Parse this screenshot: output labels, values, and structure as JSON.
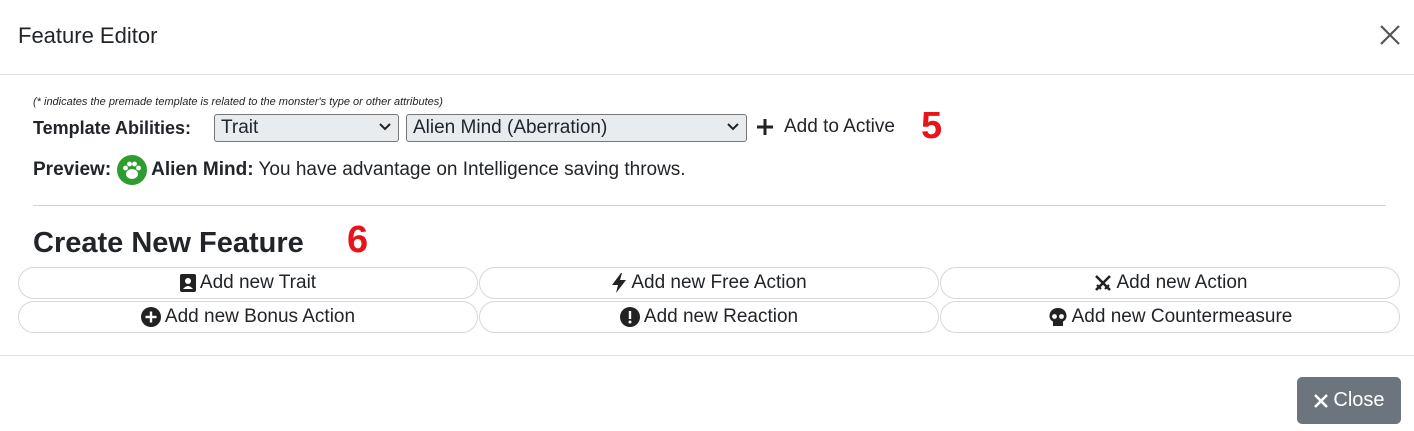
{
  "header": {
    "title": "Feature Editor",
    "close_icon": "close-icon"
  },
  "template": {
    "note": "(* indicates the premade template is related to the monster's type or other attributes)",
    "label": "Template Abilities:",
    "type_select": "Trait",
    "ability_select": "Alien Mind (Aberration)",
    "add_label": "Add to Active",
    "step_marker": "5"
  },
  "preview": {
    "label": "Preview:",
    "icon": "paw-icon",
    "name": "Alien Mind:",
    "text": " You have advantage on Intelligence saving throws."
  },
  "create": {
    "title": "Create New Feature",
    "step_marker": "6",
    "buttons": [
      {
        "label": "Add new Trait",
        "icon": "portrait-icon"
      },
      {
        "label": "Add new Free Action",
        "icon": "bolt-icon"
      },
      {
        "label": "Add new Action",
        "icon": "crossed-swords-icon"
      },
      {
        "label": "Add new Bonus Action",
        "icon": "plus-circle-icon"
      },
      {
        "label": "Add new Reaction",
        "icon": "exclamation-circle-icon"
      },
      {
        "label": "Add new Countermeasure",
        "icon": "skull-icon"
      }
    ]
  },
  "footer": {
    "close_label": "Close"
  },
  "colors": {
    "step_marker": "#e8141b",
    "paw_bg": "#2e9d2f",
    "close_btn": "#6c757d"
  }
}
